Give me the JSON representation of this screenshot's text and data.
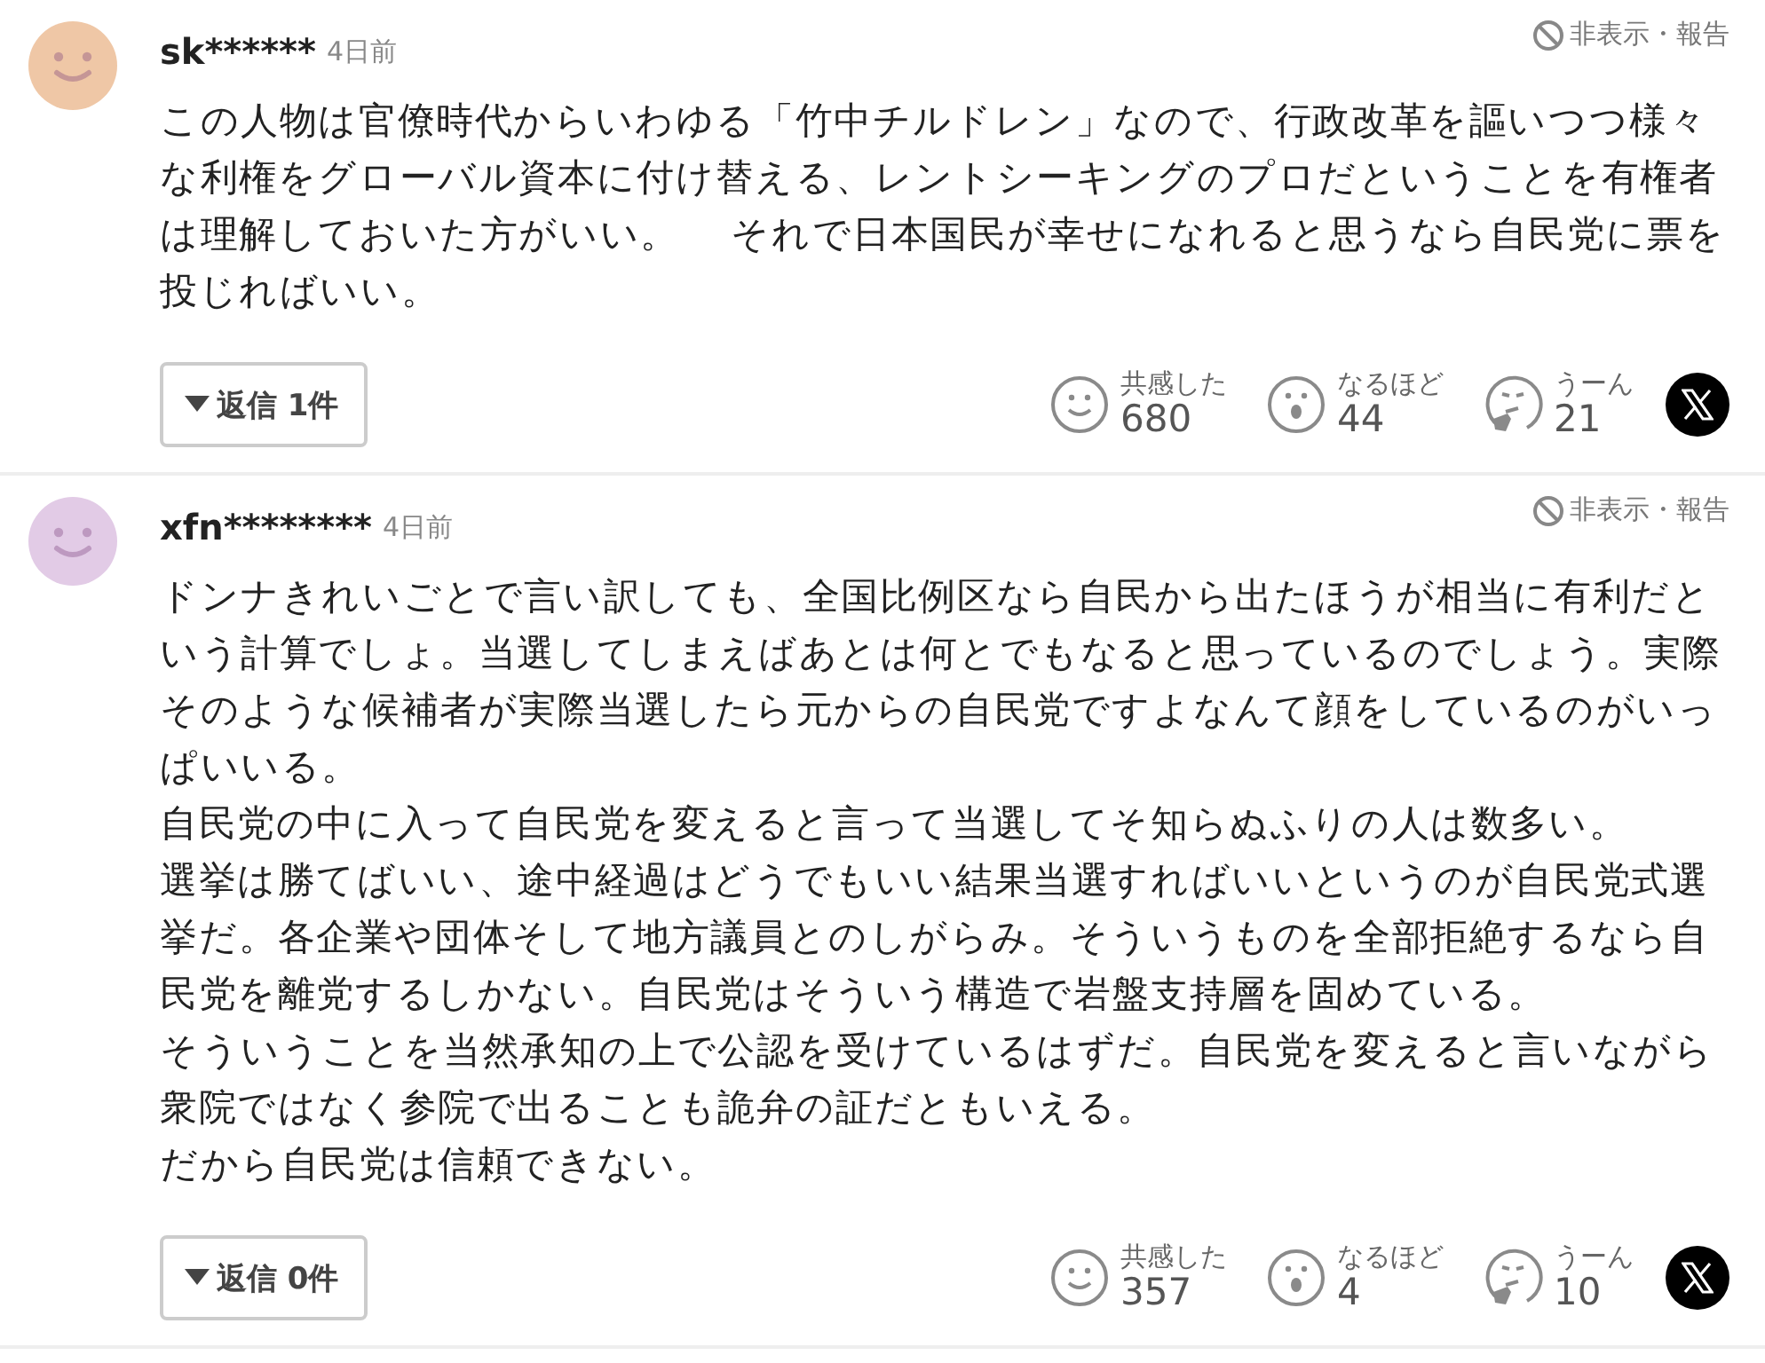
{
  "comments": [
    {
      "user": "sk******",
      "time": "4日前",
      "color": "#efc7a6",
      "actions": "非表示・報告",
      "paragraphs": [
        "この人物は官僚時代からいわゆる「竹中チルドレン」なので、行政改革を謳いつつ様々な利権をグローバル資本に付け替える、レントシーキングのプロだということを有権者は理解しておいた方がいい。　 それで日本国民が幸せになれると思うなら自民党に票を投じればいい。"
      ],
      "replies": "返信 1件",
      "reactions": [
        {
          "kind": "smile",
          "label": "共感した",
          "count": "680"
        },
        {
          "kind": "surprise",
          "label": "なるほど",
          "count": "44"
        },
        {
          "kind": "think",
          "label": "うーん",
          "count": "21"
        }
      ]
    },
    {
      "user": "xfn********",
      "time": "4日前",
      "color": "#e2cbe6",
      "actions": "非表示・報告",
      "paragraphs": [
        "ドンナきれいごとで言い訳しても、全国比例区なら自民から出たほうが相当に有利だという計算でしょ。当選してしまえばあとは何とでもなると思っているのでしょう。実際そのような候補者が実際当選したら元からの自民党ですよなんて顔をしているのがいっぱいいる。",
        "自民党の中に入って自民党を変えると言って当選してそ知らぬふりの人は数多い。",
        "選挙は勝てばいい、途中経過はどうでもいい結果当選すればいいというのが自民党式選挙だ。各企業や団体そして地方議員とのしがらみ。そういうものを全部拒絶するなら自民党を離党するしかない。自民党はそういう構造で岩盤支持層を固めている。",
        "そういうことを当然承知の上で公認を受けているはずだ。自民党を変えると言いながら衆院ではなく参院で出ることも詭弁の証だともいえる。",
        "だから自民党は信頼できない。"
      ],
      "replies": "返信 0件",
      "reactions": [
        {
          "kind": "smile",
          "label": "共感した",
          "count": "357"
        },
        {
          "kind": "surprise",
          "label": "なるほど",
          "count": "4"
        },
        {
          "kind": "think",
          "label": "うーん",
          "count": "10"
        }
      ]
    }
  ]
}
